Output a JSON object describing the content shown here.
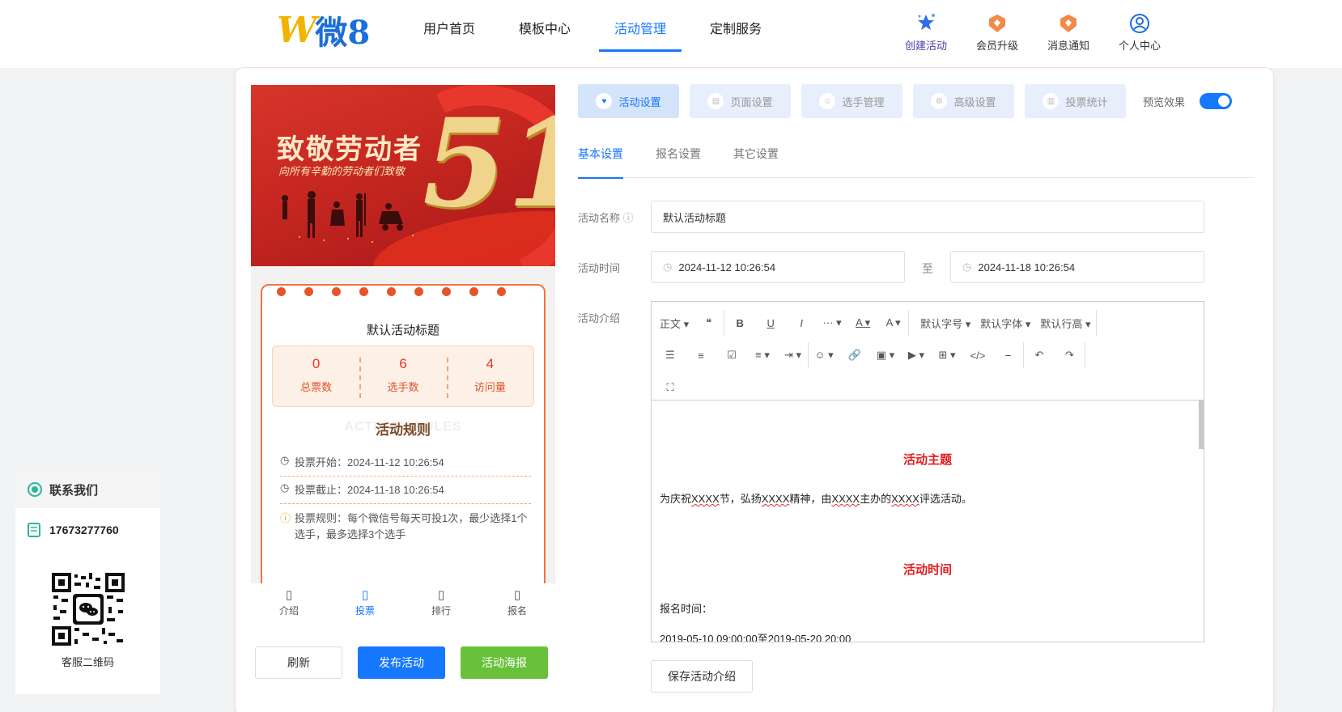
{
  "logo": {
    "w": "W",
    "name": "微8"
  },
  "nav": [
    "用户首页",
    "模板中心",
    "活动管理",
    "定制服务"
  ],
  "header_icons": [
    {
      "label": "创建活动",
      "icon": "stars-icon"
    },
    {
      "label": "会员升级",
      "icon": "vip-badge-icon"
    },
    {
      "label": "消息通知",
      "icon": "notification-badge-icon"
    },
    {
      "label": "个人中心",
      "icon": "user-icon"
    }
  ],
  "banner": {
    "title": "致敬劳动者",
    "subtitle": "向所有辛勤的劳动者们致敬",
    "number": "51"
  },
  "poster": {
    "title": "默认活动标题",
    "stats": [
      {
        "value": "0",
        "label": "总票数"
      },
      {
        "value": "6",
        "label": "选手数"
      },
      {
        "value": "4",
        "label": "访问量"
      }
    ],
    "rules_bg": "ACTIVITY RULES",
    "rules_title": "活动规则",
    "rules": [
      {
        "icon": "◷",
        "text": "投票开始：2024-11-12 10:26:54"
      },
      {
        "icon": "◷",
        "text": "投票截止：2024-11-18 10:26:54"
      },
      {
        "icon": "ⓘ",
        "text": "投票规则：每个微信号每天可投1次，最少选择1个选手，最多选择3个选手"
      }
    ]
  },
  "bottom_tabs": [
    "介绍",
    "投票",
    "排行",
    "报名"
  ],
  "left_buttons": {
    "refresh": "刷新",
    "publish": "发布活动",
    "poster": "活动海报"
  },
  "steps": [
    "活动设置",
    "页面设置",
    "选手管理",
    "高级设置",
    "投票统计"
  ],
  "preview_label": "预览效果",
  "subtabs": [
    "基本设置",
    "报名设置",
    "其它设置"
  ],
  "form": {
    "name_label": "活动名称",
    "name_value": "默认活动标题",
    "time_label": "活动时间",
    "start": "2024-11-12 10:26:54",
    "to": "至",
    "end": "2024-11-18 10:26:54",
    "intro_label": "活动介绍"
  },
  "toolbar": {
    "row1": [
      "正文 ▾",
      "❝",
      "B",
      "U",
      "I",
      "··· ▾",
      "A ▾",
      "A ▾",
      "默认字号 ▾",
      "默认字体 ▾",
      "默认行高 ▾"
    ],
    "row2": [
      "☰",
      "≡",
      "☑",
      "≡ ▾",
      "⇥ ▾",
      "☺ ▾",
      "🔗",
      "▣ ▾",
      "▶ ▾",
      "⊞ ▾",
      "</>",
      "⎯",
      "↶",
      "↷"
    ],
    "row3": [
      "⛶"
    ]
  },
  "editor": {
    "h1": "活动主题",
    "p1": [
      "为庆祝",
      "XXXX",
      "节，弘扬",
      "XXXX",
      "精神，由",
      "XXXX",
      "主办的",
      "XXXX",
      "评选活动。"
    ],
    "h2": "活动时间",
    "p2": "报名时间：",
    "p3": "2019-05-10 09:00:00至2019-05-20 20:00"
  },
  "save_intro": "保存活动介绍",
  "contact": {
    "title": "联系我们",
    "phone": "17673277760",
    "qr_label": "客服二维码"
  },
  "colors": {
    "primary": "#1677ff",
    "green": "#67c23a",
    "red": "#e31b1b"
  }
}
